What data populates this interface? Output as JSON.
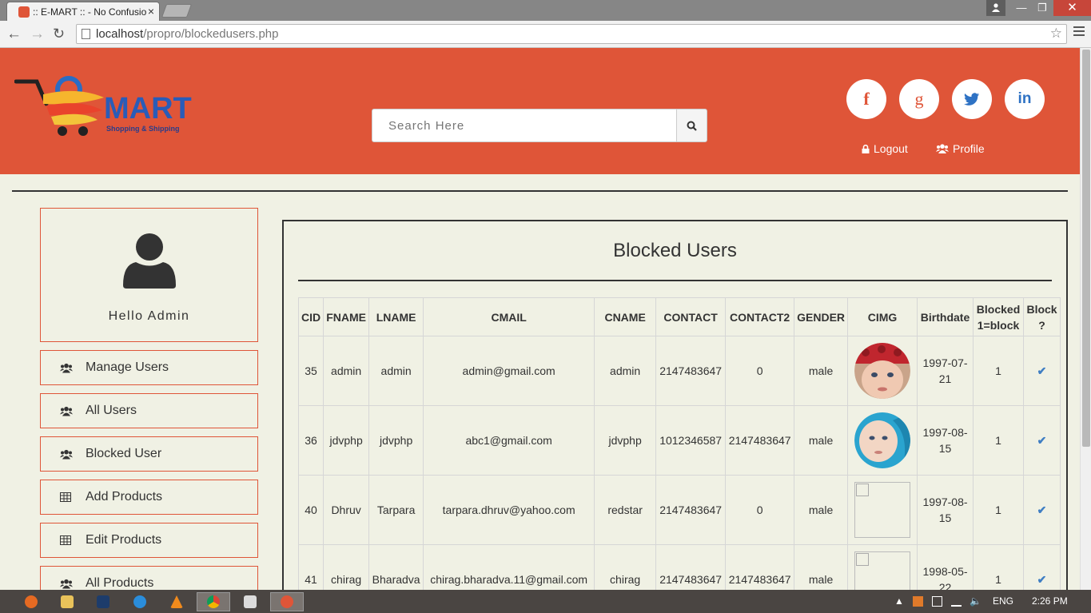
{
  "browser": {
    "tab_title": ":: E-MART :: - No Confusio",
    "tab_close": "×",
    "url_host": "localhost",
    "url_path": "/propro/blockedusers.php"
  },
  "header": {
    "logo_text": "MART",
    "logo_tagline": "Shopping & Shipping",
    "search_placeholder": "Search Here",
    "social": [
      {
        "label": "f",
        "icon": "facebook-icon"
      },
      {
        "label": "g",
        "icon": "google-icon"
      },
      {
        "label": "t",
        "icon": "twitter-icon"
      },
      {
        "label": "in",
        "icon": "linkedin-icon"
      }
    ],
    "logout_label": "Logout",
    "profile_label": "Profile"
  },
  "sidebar": {
    "greeting": "Hello Admin",
    "items": [
      {
        "label": "Manage Users",
        "icon": "users-icon"
      },
      {
        "label": "All Users",
        "icon": "users-icon"
      },
      {
        "label": "Blocked User",
        "icon": "users-icon"
      },
      {
        "label": "Add Products",
        "icon": "table-icon"
      },
      {
        "label": "Edit Products",
        "icon": "table-icon"
      },
      {
        "label": "All Products",
        "icon": "users-icon"
      }
    ]
  },
  "main": {
    "title": "Blocked Users",
    "columns": [
      "CID",
      "FNAME",
      "LNAME",
      "CMAIL",
      "CNAME",
      "CONTACT",
      "CONTACT2",
      "GENDER",
      "CIMG",
      "Birthdate",
      "Blocked 1=block",
      "Block ?"
    ],
    "rows": [
      {
        "cid": "35",
        "fname": "admin",
        "lname": "admin",
        "cmail": "admin@gmail.com",
        "cname": "admin",
        "contact": "2147483647",
        "contact2": "0",
        "gender": "male",
        "cimg": "photo-baby-red-hat",
        "birthdate": "1997-07-21",
        "blocked": "1",
        "block_icon": "check-icon"
      },
      {
        "cid": "36",
        "fname": "jdvphp",
        "lname": "jdvphp",
        "cmail": "abc1@gmail.com",
        "cname": "jdvphp",
        "contact": "1012346587",
        "contact2": "2147483647",
        "gender": "male",
        "cimg": "photo-baby-blue",
        "birthdate": "1997-08-15",
        "blocked": "1",
        "block_icon": "check-icon"
      },
      {
        "cid": "40",
        "fname": "Dhruv",
        "lname": "Tarpara",
        "cmail": "tarpara.dhruv@yahoo.com",
        "cname": "redstar",
        "contact": "2147483647",
        "contact2": "0",
        "gender": "male",
        "cimg": "broken-image",
        "birthdate": "1997-08-15",
        "blocked": "1",
        "block_icon": "check-icon"
      },
      {
        "cid": "41",
        "fname": "chirag",
        "lname": "Bharadva",
        "cmail": "chirag.bharadva.11@gmail.com",
        "cname": "chirag",
        "contact": "2147483647",
        "contact2": "2147483647",
        "gender": "male",
        "cimg": "broken-image",
        "birthdate": "1998-05-22",
        "blocked": "1",
        "block_icon": "check-icon"
      }
    ]
  },
  "taskbar": {
    "language": "ENG",
    "time": "2:26 PM"
  },
  "colors": {
    "header_bg": "#df5538",
    "page_bg": "#f0f1e4",
    "check": "#3f7ec3"
  }
}
